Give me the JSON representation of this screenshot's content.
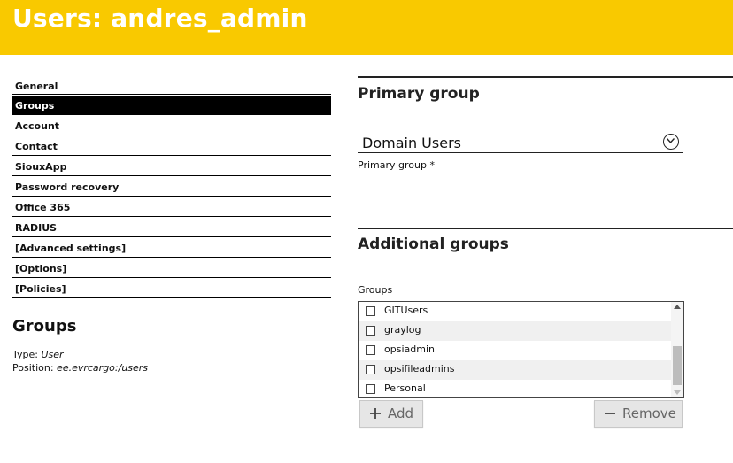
{
  "header": {
    "title": "Users: andres_admin",
    "background": "#f9c900"
  },
  "nav": {
    "items": [
      {
        "label": "General",
        "active": false
      },
      {
        "label": "Groups",
        "active": true
      },
      {
        "label": "Account",
        "active": false
      },
      {
        "label": "Contact",
        "active": false
      },
      {
        "label": "SiouxApp",
        "active": false
      },
      {
        "label": "Password recovery",
        "active": false
      },
      {
        "label": "Office 365",
        "active": false
      },
      {
        "label": "RADIUS",
        "active": false
      },
      {
        "label": "[Advanced settings]",
        "active": false
      },
      {
        "label": "[Options]",
        "active": false
      },
      {
        "label": "[Policies]",
        "active": false
      }
    ]
  },
  "info": {
    "title": "Groups",
    "type_label": "Type:",
    "type_value": "User",
    "position_label": "Position:",
    "position_value": "ee.evrcargo:/users"
  },
  "primary_group": {
    "section_title": "Primary group",
    "selected_value": "Domain Users",
    "field_label": "Primary group *",
    "chevron_icon": "chevron-down-circle-icon"
  },
  "additional_groups": {
    "section_title": "Additional groups",
    "field_label": "Groups",
    "items": [
      {
        "label": "GITUsers",
        "checked": false
      },
      {
        "label": "graylog",
        "checked": false
      },
      {
        "label": "opsiadmin",
        "checked": false
      },
      {
        "label": "opsifileadmins",
        "checked": false
      },
      {
        "label": "Personal",
        "checked": false
      }
    ],
    "scroll_position": 0.7
  },
  "buttons": {
    "add_label": "Add",
    "add_icon": "plus-icon",
    "remove_label": "Remove",
    "remove_icon": "minus-icon"
  }
}
